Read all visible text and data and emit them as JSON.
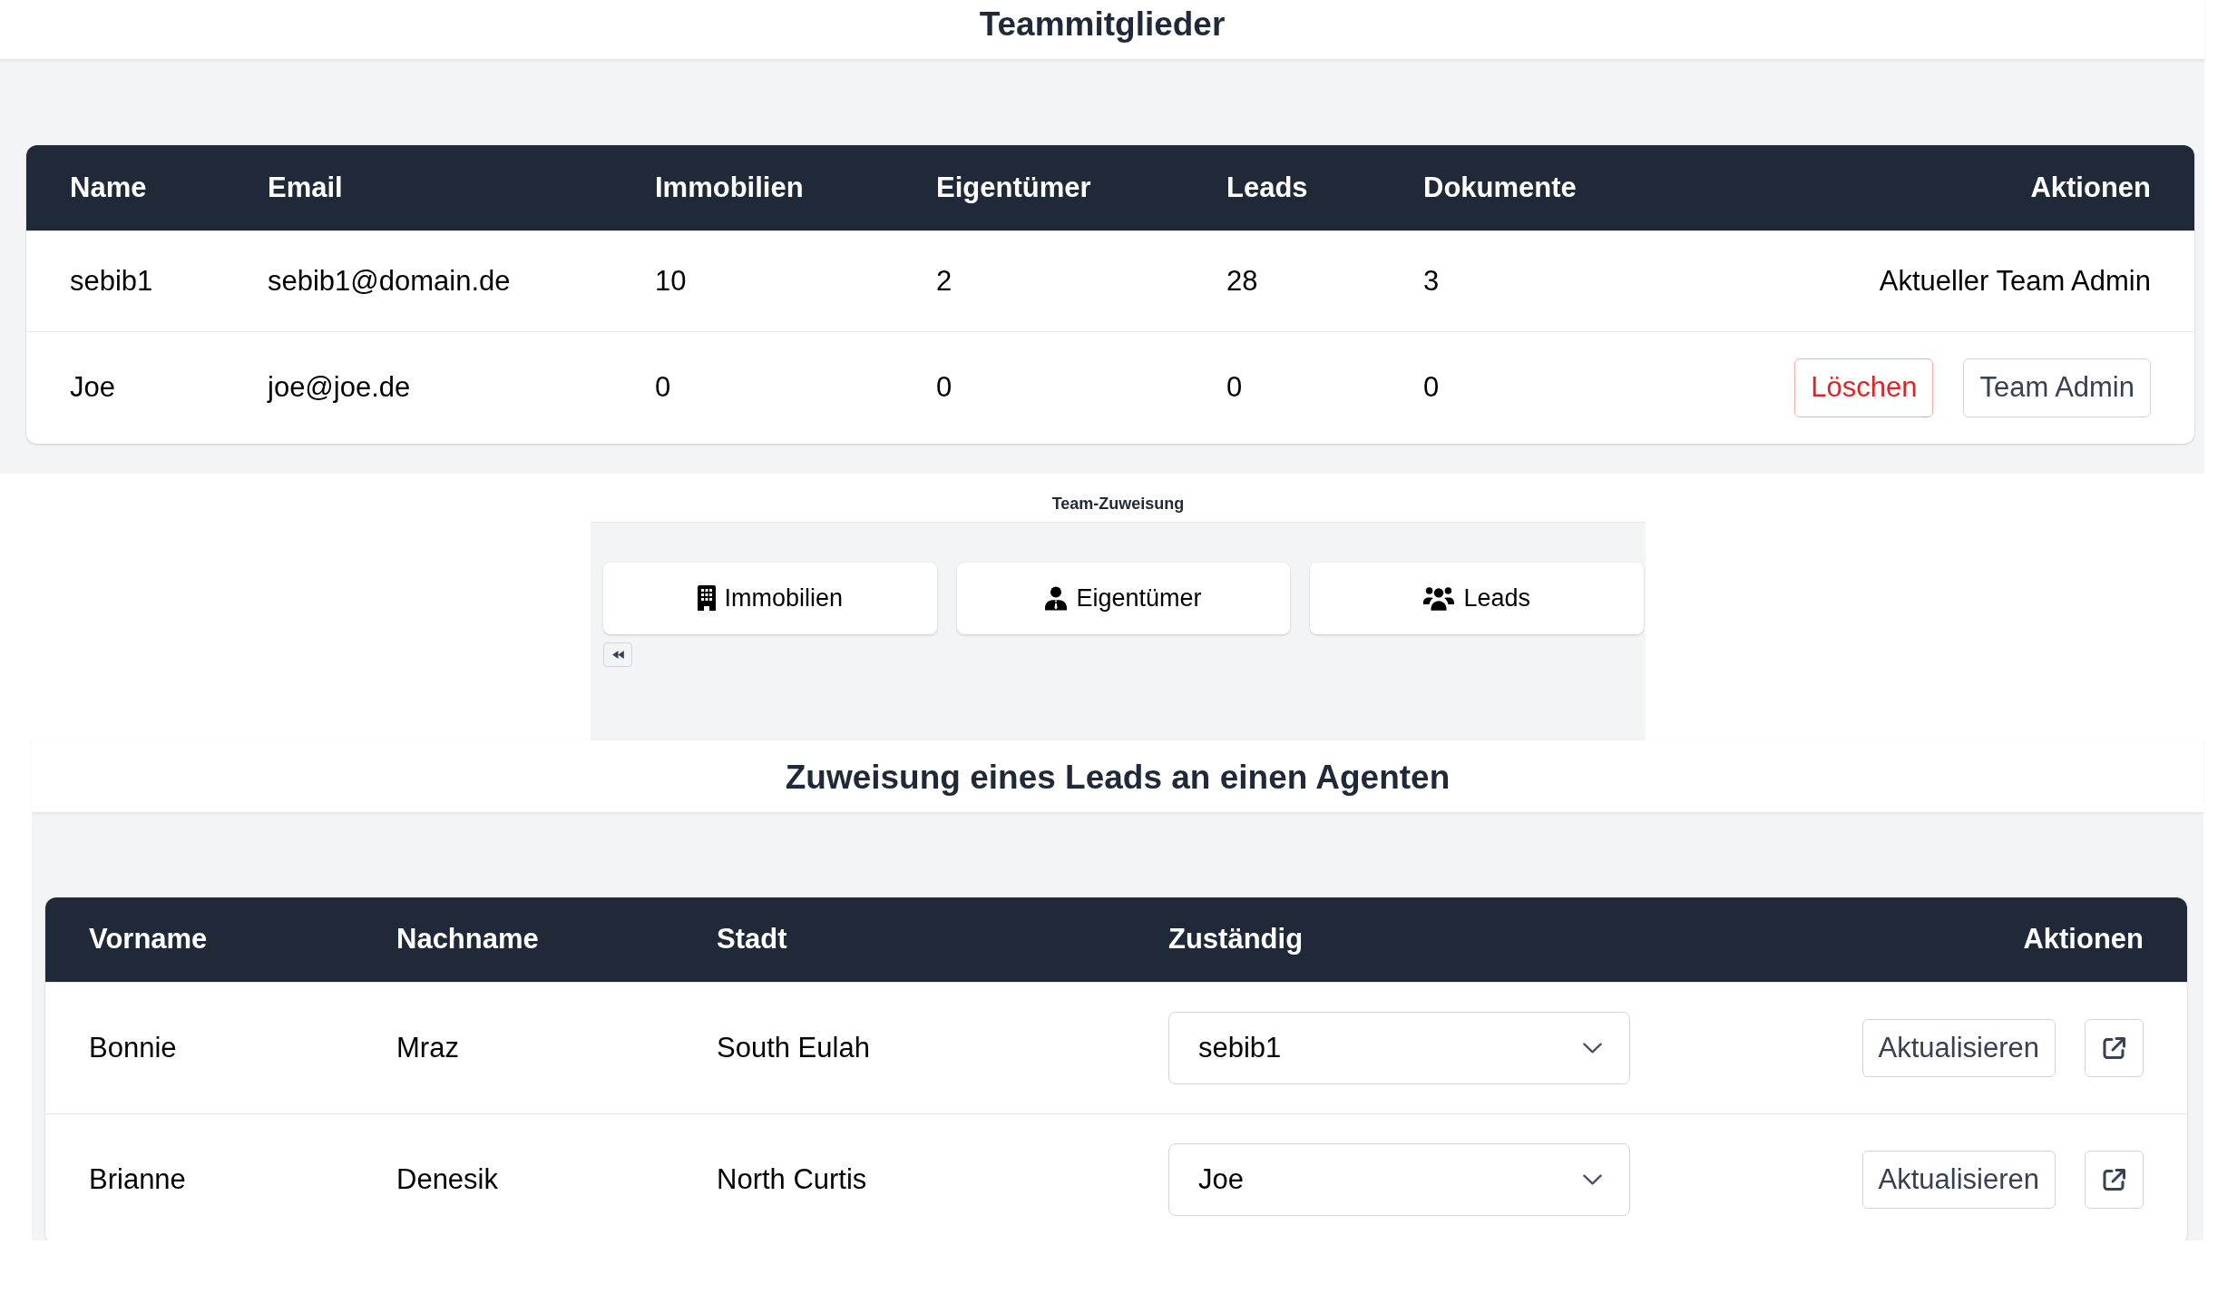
{
  "header": {
    "title": "Teammitglieder"
  },
  "team_members": {
    "columns": [
      "Name",
      "Email",
      "Immobilien",
      "Eigentümer",
      "Leads",
      "Dokumente",
      "Aktionen"
    ],
    "rows": [
      {
        "cells": [
          "sebib1",
          "sebib1@domain.de",
          "10",
          "2",
          "28",
          "3"
        ],
        "actions": {
          "kind": "note",
          "text": "Aktueller Team Admin"
        }
      },
      {
        "cells": [
          "Joe",
          "joe@joe.de",
          "0",
          "0",
          "0",
          "0"
        ],
        "actions": {
          "kind": "buttons",
          "buttons": [
            {
              "label": "Löschen",
              "kind": "danger"
            },
            {
              "label": "Team Admin",
              "kind": "default"
            }
          ]
        }
      }
    ]
  },
  "team_assignment": {
    "title": "Team-Zuweisung",
    "tabs": [
      {
        "label": "Immobilien"
      },
      {
        "label": "Eigentümer"
      },
      {
        "label": "Leads"
      }
    ]
  },
  "lead_assignment": {
    "title": "Zuweisung eines Leads an einen Agenten",
    "columns": [
      "Vorname",
      "Nachname",
      "Stadt",
      "Zuständig",
      "Aktionen"
    ],
    "rows": [
      {
        "cells": [
          "Bonnie",
          "Mraz",
          "South Eulah"
        ],
        "assigned_to": "sebib1",
        "update_button": "Aktualisieren"
      },
      {
        "cells": [
          "Brianne",
          "Denesik",
          "North Curtis"
        ],
        "assigned_to": "Joe",
        "update_button": "Aktualisieren"
      }
    ]
  }
}
